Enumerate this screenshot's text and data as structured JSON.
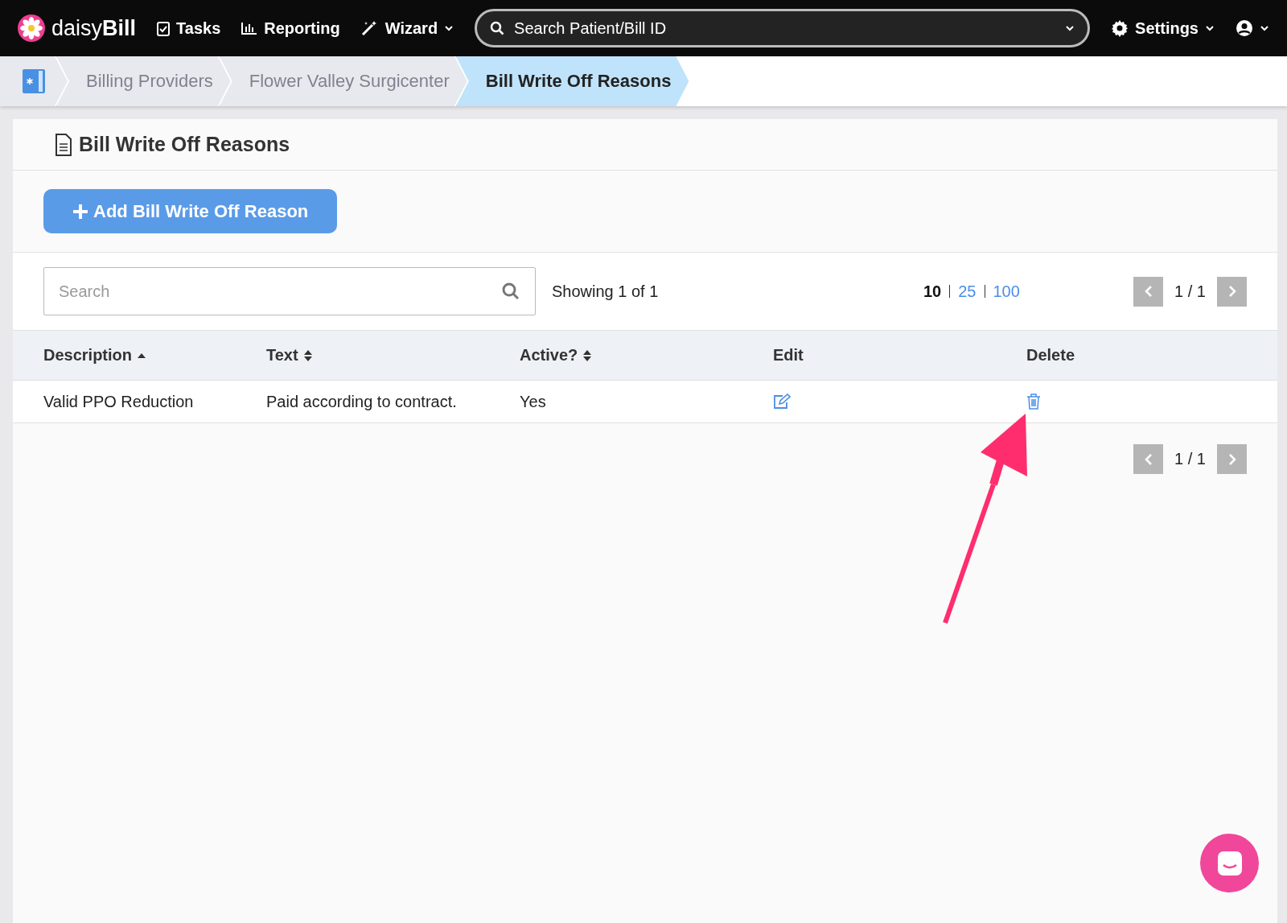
{
  "nav": {
    "brand": {
      "light": "daisy",
      "bold": "Bill"
    },
    "items": [
      {
        "label": "Tasks",
        "kind": "tasks"
      },
      {
        "label": "Reporting",
        "kind": "reporting"
      },
      {
        "label": "Wizard",
        "kind": "wizard"
      }
    ],
    "search": {
      "placeholder": "Search Patient/Bill ID"
    },
    "settings": "Settings"
  },
  "breadcrumbs": [
    {
      "label": "Billing Providers",
      "selected": false
    },
    {
      "label": "Flower Valley Surgicenter",
      "selected": false
    },
    {
      "label": "Bill Write Off Reasons",
      "selected": true
    }
  ],
  "panel": {
    "title": "Bill Write Off Reasons",
    "add_button": "Add Bill Write Off Reason"
  },
  "filter": {
    "placeholder": "Search",
    "showing": "Showing 1 of 1",
    "page_sizes": [
      {
        "label": "10",
        "selected": true
      },
      {
        "label": "25",
        "selected": false
      },
      {
        "label": "100",
        "selected": false
      }
    ],
    "page": "1 / 1"
  },
  "table": {
    "columns": [
      {
        "label": "Description",
        "sortable": true,
        "sorted": true
      },
      {
        "label": "Text",
        "sortable": true,
        "sorted": false
      },
      {
        "label": "Active?",
        "sortable": true,
        "sorted": false
      },
      {
        "label": "Edit",
        "sortable": false
      },
      {
        "label": "Delete",
        "sortable": false
      }
    ],
    "rows": [
      {
        "description": "Valid PPO Reduction",
        "text": "Paid according to contract.",
        "active": "Yes"
      }
    ]
  },
  "bottom_pager": {
    "page": "1 / 1"
  }
}
